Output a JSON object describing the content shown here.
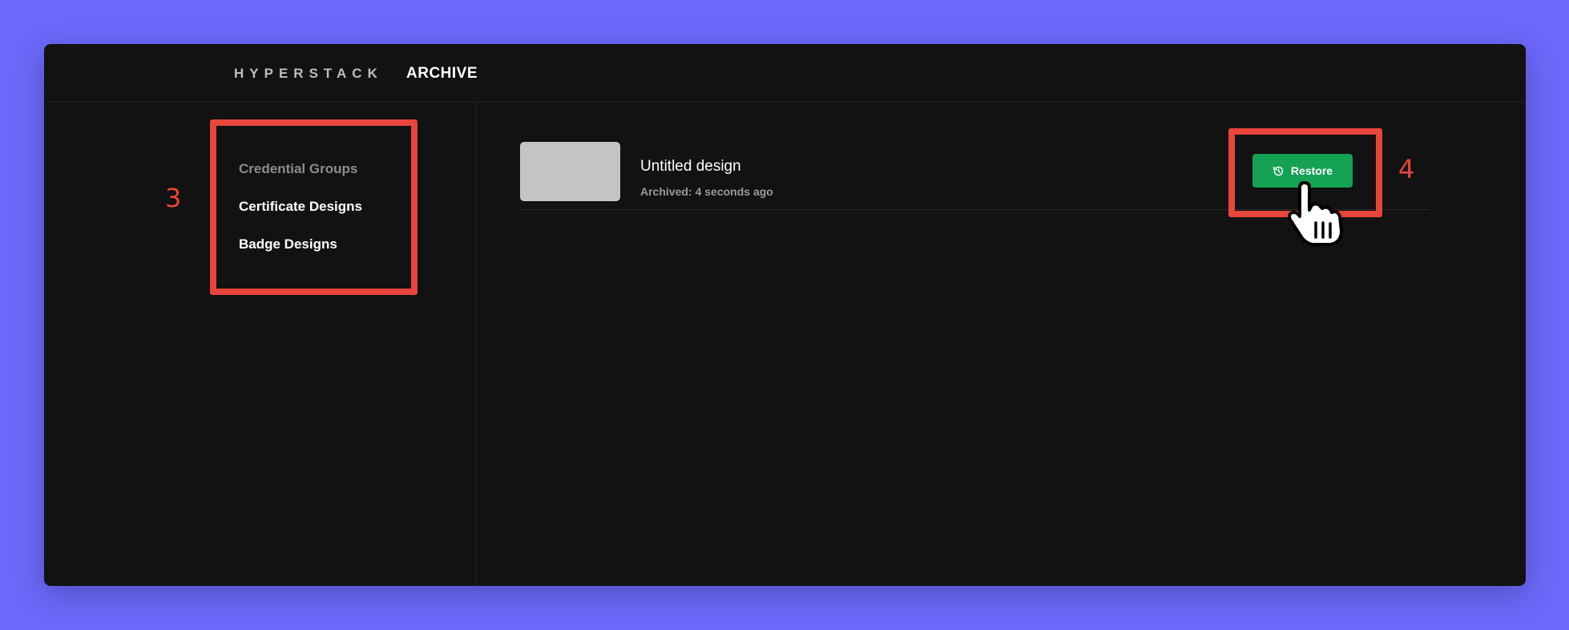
{
  "header": {
    "brand": "HYPERSTACK",
    "section": "ARCHIVE"
  },
  "sidebar": {
    "items": [
      {
        "label": "Credential Groups"
      },
      {
        "label": "Certificate Designs"
      },
      {
        "label": "Badge Designs"
      }
    ]
  },
  "archive": {
    "items": [
      {
        "name": "Untitled design",
        "archived_label": "Archived:",
        "archived_time": "4 seconds ago",
        "restore_label": "Restore",
        "restore_icon": "history-icon"
      }
    ]
  },
  "annotations": {
    "step_3": "3",
    "step_4": "4"
  },
  "colors": {
    "page_background": "#6c69fb",
    "app_background": "#121212",
    "restore_button": "#15a254",
    "annotation": "#e8453c"
  }
}
